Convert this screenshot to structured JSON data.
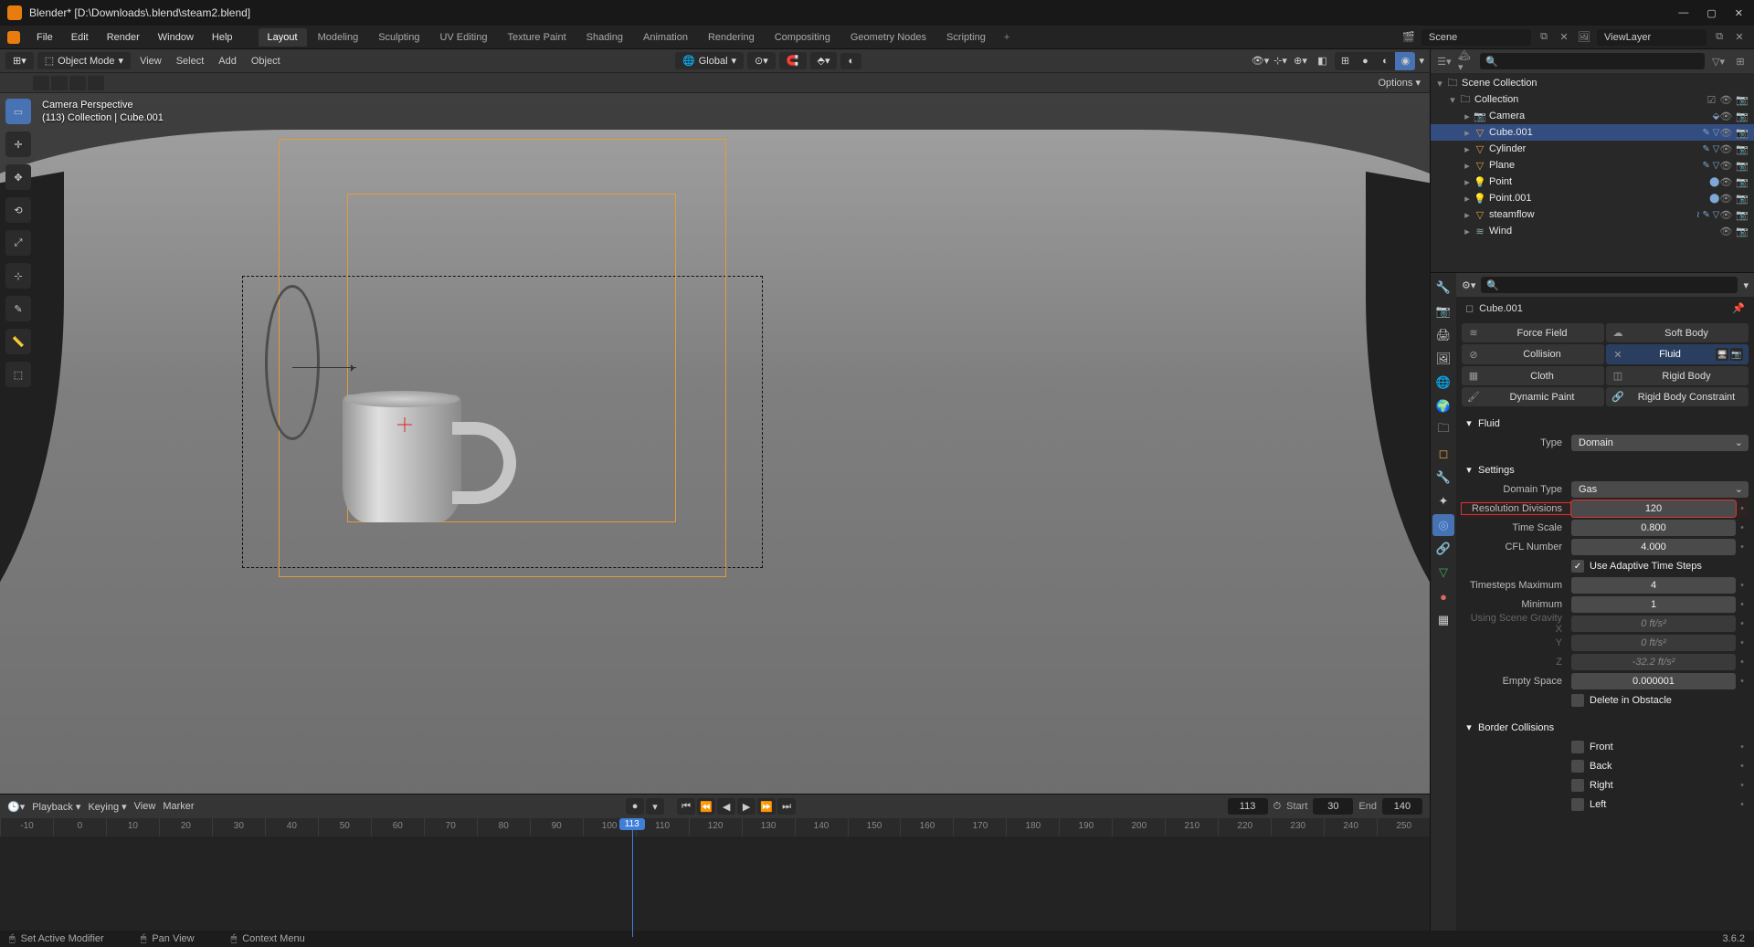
{
  "titlebar": {
    "text": "Blender* [D:\\Downloads\\.blend\\steam2.blend]"
  },
  "topmenu": {
    "items": [
      "File",
      "Edit",
      "Render",
      "Window",
      "Help"
    ],
    "tabs": [
      "Layout",
      "Modeling",
      "Sculpting",
      "UV Editing",
      "Texture Paint",
      "Shading",
      "Animation",
      "Rendering",
      "Compositing",
      "Geometry Nodes",
      "Scripting"
    ],
    "active_tab": 0,
    "scene_label": "Scene",
    "viewlayer_label": "ViewLayer"
  },
  "viewport": {
    "mode": "Object Mode",
    "menus": [
      "View",
      "Select",
      "Add",
      "Object"
    ],
    "orientation": "Global",
    "options_label": "Options",
    "overlay": {
      "l1": "Camera Perspective",
      "l2": "(113) Collection | Cube.001"
    }
  },
  "timeline": {
    "left": {
      "playback": "Playback",
      "keying": "Keying",
      "view": "View",
      "marker": "Marker"
    },
    "current": "113",
    "start_lbl": "Start",
    "start": "30",
    "end_lbl": "End",
    "end": "140",
    "ticks": [
      "-10",
      "0",
      "10",
      "20",
      "30",
      "40",
      "50",
      "60",
      "70",
      "80",
      "90",
      "100",
      "110",
      "120",
      "130",
      "140",
      "150",
      "160",
      "170",
      "180",
      "190",
      "200",
      "210",
      "220",
      "230",
      "240",
      "250"
    ]
  },
  "outliner": {
    "root": "Scene Collection",
    "collection": "Collection",
    "items": [
      {
        "name": "Camera",
        "icon": "cam",
        "badges": "⬙"
      },
      {
        "name": "Cube.001",
        "icon": "mesh",
        "badges": "✎ ▽",
        "selected": true
      },
      {
        "name": "Cylinder",
        "icon": "mesh",
        "badges": "✎ ▽"
      },
      {
        "name": "Plane",
        "icon": "mesh",
        "badges": "✎ ▽"
      },
      {
        "name": "Point",
        "icon": "light",
        "badges": "⬤"
      },
      {
        "name": "Point.001",
        "icon": "light",
        "badges": "⬤"
      },
      {
        "name": "steamflow",
        "icon": "mesh",
        "badges": "≀ ✎ ▽"
      },
      {
        "name": "Wind",
        "icon": "wind",
        "badges": ""
      }
    ]
  },
  "props": {
    "crumb": "Cube.001",
    "physics": {
      "force_field": "Force Field",
      "soft_body": "Soft Body",
      "collision": "Collision",
      "fluid": "Fluid",
      "cloth": "Cloth",
      "rigid_body": "Rigid Body",
      "dynamic_paint": "Dynamic Paint",
      "rigid_body_constraint": "Rigid Body Constraint"
    },
    "fluid_header": "Fluid",
    "type_lbl": "Type",
    "type_val": "Domain",
    "settings_header": "Settings",
    "domain_type_lbl": "Domain Type",
    "domain_type_val": "Gas",
    "res_lbl": "Resolution Divisions",
    "res_val": "120",
    "timescale_lbl": "Time Scale",
    "timescale_val": "0.800",
    "cfl_lbl": "CFL Number",
    "cfl_val": "4.000",
    "adaptive_lbl": "Use Adaptive Time Steps",
    "ts_max_lbl": "Timesteps Maximum",
    "ts_max_val": "4",
    "ts_min_lbl": "Minimum",
    "ts_min_val": "1",
    "grav_lbl": "Using Scene Gravity X",
    "grav_x": "0 ft/s²",
    "grav_y_lbl": "Y",
    "grav_y": "0 ft/s²",
    "grav_z_lbl": "Z",
    "grav_z": "-32.2 ft/s²",
    "empty_lbl": "Empty Space",
    "empty_val": "0.000001",
    "delete_obstacle_lbl": "Delete in Obstacle",
    "border_header": "Border Collisions",
    "borders": [
      "Front",
      "Back",
      "Right",
      "Left"
    ]
  },
  "status": {
    "a": "Set Active Modifier",
    "b": "Pan View",
    "c": "Context Menu",
    "ver": "3.6.2"
  }
}
